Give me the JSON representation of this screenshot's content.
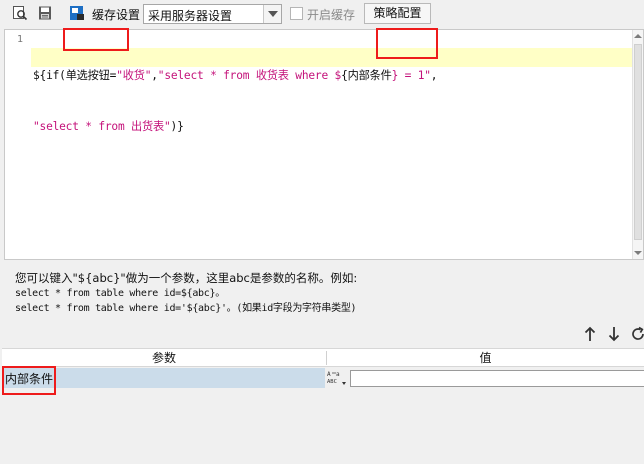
{
  "toolbar": {
    "cache_settings_label": "缓存设置",
    "cache_mode_selected": "采用服务器设置",
    "enable_cache_label": "开启缓存",
    "enable_cache_checked": false,
    "policy_config_label": "策略配置"
  },
  "editor": {
    "line_number": "1",
    "code_tokens_line1": [
      {
        "text": "${if(",
        "kind": "plain"
      },
      {
        "text": "单选按钮",
        "kind": "plain"
      },
      {
        "text": "=",
        "kind": "plain"
      },
      {
        "text": "\"收货\"",
        "kind": "str"
      },
      {
        "text": ",",
        "kind": "plain"
      },
      {
        "text": "\"select * from 收货表 where $",
        "kind": "str"
      },
      {
        "text": "{",
        "kind": "plain"
      },
      {
        "text": "内部条件",
        "kind": "plain"
      },
      {
        "text": "} = 1\"",
        "kind": "str"
      },
      {
        "text": ",",
        "kind": "plain"
      }
    ],
    "code_tokens_line2": [
      {
        "text": "\"select * from 出货表\"",
        "kind": "str"
      },
      {
        "text": ")}",
        "kind": "plain"
      }
    ]
  },
  "help": {
    "line1": "您可以键入\"${abc}\"做为一个参数，这里abc是参数的名称。例如:",
    "line2": "select * from table where id=${abc}。",
    "line3": "select * from table where id='${abc}'。(如果id字段为字符串类型)"
  },
  "params_table": {
    "col_param": "参数",
    "col_value": "值",
    "rows": [
      {
        "name": "内部条件",
        "type_badge": "ABC",
        "value": ""
      }
    ]
  },
  "colors": {
    "annotation_red": "#ee1b1b",
    "string_magenta": "#c4127a",
    "highlight_yellow": "#ffffc6",
    "row_selected": "#cbdcea"
  }
}
